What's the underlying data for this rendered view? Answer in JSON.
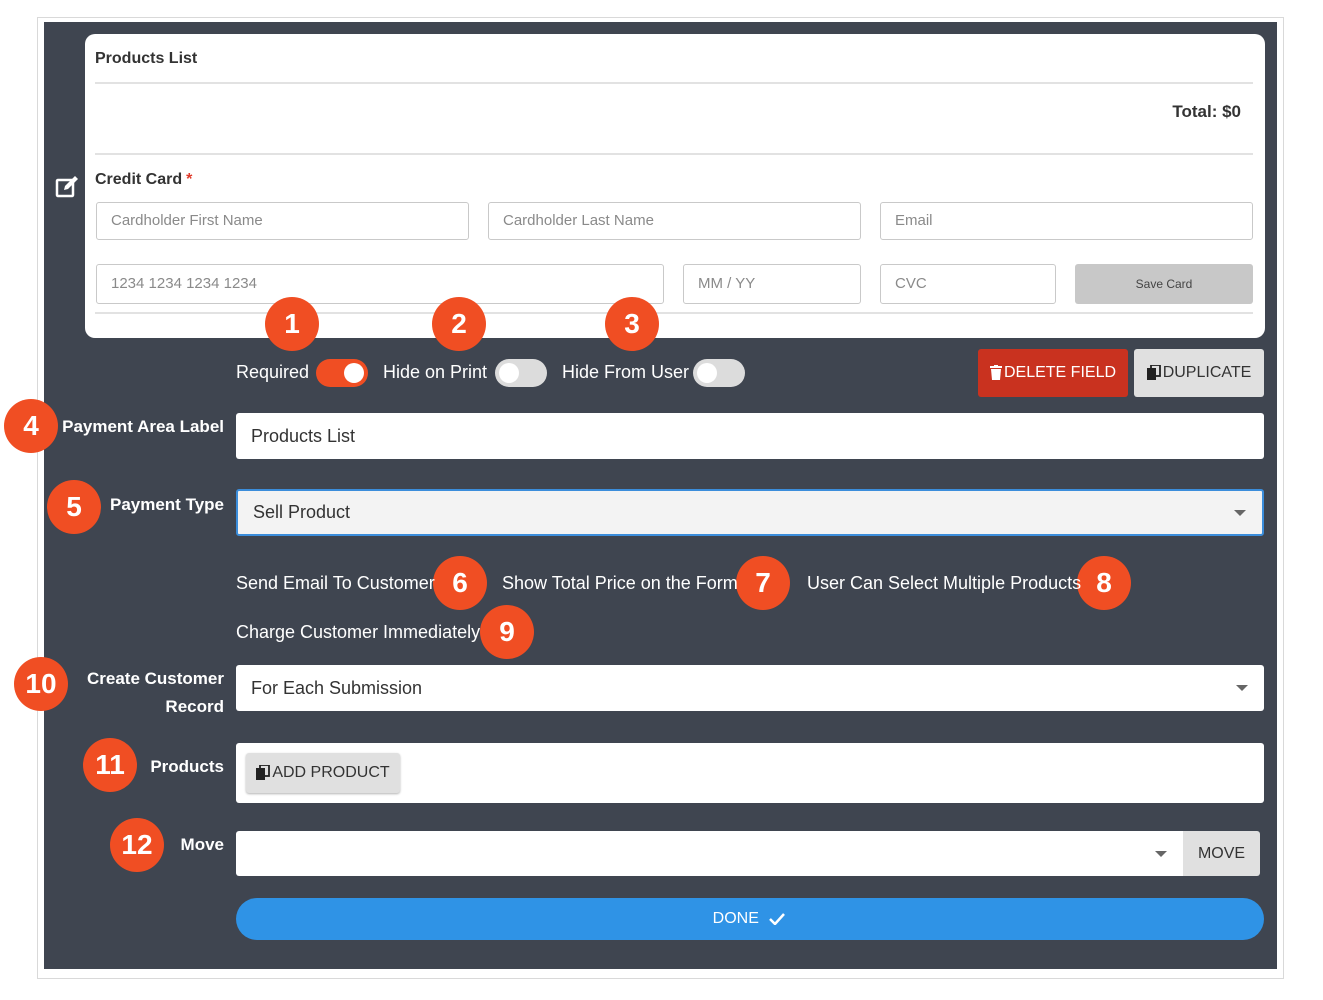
{
  "preview": {
    "title": "Products List",
    "total": "Total: $0",
    "credit_card_label": "Credit Card",
    "required_mark": "*",
    "placeholders": {
      "first_name": "Cardholder First Name",
      "last_name": "Cardholder Last Name",
      "email": "Email",
      "card_number": "1234 1234 1234 1234",
      "expiry": "MM / YY",
      "cvc": "CVC"
    },
    "save_card": "Save Card"
  },
  "toggles": {
    "required": {
      "label": "Required",
      "on": true
    },
    "hide_on_print": {
      "label": "Hide on Print",
      "on": false
    },
    "hide_from_user": {
      "label": "Hide From User",
      "on": false
    }
  },
  "buttons": {
    "delete_field": "DELETE FIELD",
    "duplicate": "DUPLICATE",
    "add_product": "ADD PRODUCT",
    "move": "MOVE",
    "done": "DONE"
  },
  "fields": {
    "payment_area_label": {
      "label": "Payment Area Label",
      "value": "Products List"
    },
    "payment_type": {
      "label": "Payment Type",
      "value": "Sell Product"
    },
    "create_customer_record": {
      "label_line1": "Create Customer",
      "label_line2": "Record",
      "value": "For Each Submission"
    },
    "products": {
      "label": "Products"
    },
    "move": {
      "label": "Move",
      "value": ""
    }
  },
  "options": {
    "send_email": "Send Email To Customer",
    "show_total": "Show Total Price on the Form",
    "multiple_products": "User Can Select Multiple Products",
    "charge_immediately": "Charge Customer Immediately"
  },
  "badges": [
    "1",
    "2",
    "3",
    "4",
    "5",
    "6",
    "7",
    "8",
    "9",
    "10",
    "11",
    "12"
  ],
  "colors": {
    "panel": "#3f4550",
    "badge": "#f04e23",
    "delete": "#c9321f",
    "done": "#2f93e6",
    "select_border": "#3b8ddb"
  },
  "icons": [
    "edit-icon",
    "trash-icon",
    "copy-icon",
    "checkmark-icon",
    "chevron-down-icon"
  ]
}
